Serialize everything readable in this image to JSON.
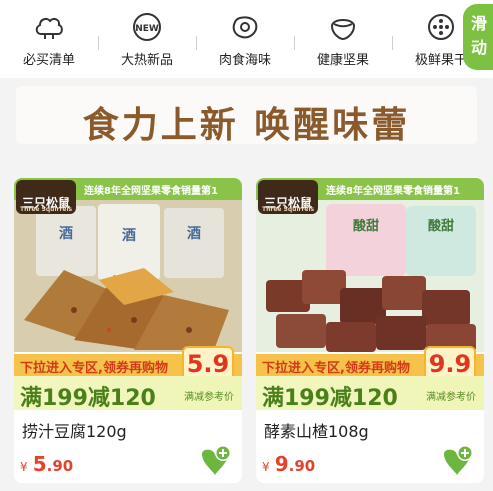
{
  "nav": {
    "items": [
      {
        "label": "必买清单",
        "icon": "cloud-icon"
      },
      {
        "label": "大热新品",
        "icon": "new-badge-icon"
      },
      {
        "label": "肉食海味",
        "icon": "meat-icon"
      },
      {
        "label": "健康坚果",
        "icon": "nut-icon"
      },
      {
        "label": "极鲜果干",
        "icon": "fruit-icon"
      }
    ],
    "side_tab": "滑动"
  },
  "banner": {
    "title": "食力上新 唤醒味蕾"
  },
  "products": [
    {
      "brand": "三只松鼠",
      "brand_sub": "Three Squirrels",
      "strip_text": "连续8年全网坚果零食销量第1",
      "promo_top": "下拉进入专区,领券再购物",
      "price_tag": "5.9",
      "promo_bar": "满199减120",
      "promo_sub": "满减参考价",
      "name": "捞汁豆腐120g",
      "currency": "¥",
      "price_int": "5",
      "price_dec": ".90"
    },
    {
      "brand": "三只松鼠",
      "brand_sub": "Three Squirrels",
      "strip_text": "连续8年全网坚果零食销量第1",
      "promo_top": "下拉进入专区,领券再购物",
      "price_tag": "9.9",
      "promo_bar": "满199减120",
      "promo_sub": "满减参考价",
      "name": "酵素山楂108g",
      "currency": "¥",
      "price_int": "9",
      "price_dec": ".90"
    }
  ],
  "colors": {
    "accent_green": "#7cc142",
    "price_red": "#e5422a",
    "banner_brown": "#8a5a2c"
  }
}
